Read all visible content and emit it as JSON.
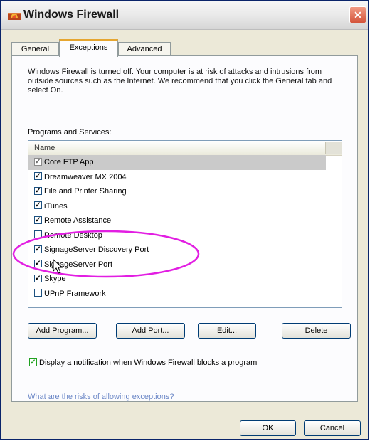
{
  "window": {
    "title": "Windows Firewall"
  },
  "tabs": [
    {
      "label": "General",
      "active": false
    },
    {
      "label": "Exceptions",
      "active": true
    },
    {
      "label": "Advanced",
      "active": false
    }
  ],
  "exceptions": {
    "warning": "Windows Firewall is turned off. Your computer is at risk of attacks and intrusions from outside sources such as the Internet. We recommend that you click the General tab and select On.",
    "section_label": "Programs and Services:",
    "column_header": "Name",
    "items": [
      {
        "label": "Core FTP App",
        "checked": true,
        "selected": true
      },
      {
        "label": "Dreamweaver MX 2004",
        "checked": true,
        "selected": false
      },
      {
        "label": "File and Printer Sharing",
        "checked": true,
        "selected": false
      },
      {
        "label": "iTunes",
        "checked": true,
        "selected": false
      },
      {
        "label": "Remote Assistance",
        "checked": true,
        "selected": false
      },
      {
        "label": "Remote Desktop",
        "checked": false,
        "selected": false
      },
      {
        "label": "SignageServer Discovery Port",
        "checked": true,
        "selected": false
      },
      {
        "label": "SignageServer Port",
        "checked": true,
        "selected": false
      },
      {
        "label": "Skype",
        "checked": true,
        "selected": false
      },
      {
        "label": "UPnP Framework",
        "checked": false,
        "selected": false
      }
    ],
    "buttons": {
      "add_program": "Add Program...",
      "add_port": "Add Port...",
      "edit": "Edit...",
      "delete": "Delete"
    },
    "notify_label": "Display a notification when Windows Firewall blocks a program",
    "notify_checked": true,
    "risk_link": "What are the risks of allowing exceptions?"
  },
  "dialog_buttons": {
    "ok": "OK",
    "cancel": "Cancel"
  },
  "colors": {
    "highlight_ellipse": "#e21ee2",
    "active_tab_accent": "#e6a630",
    "selected_row": "#cacaca",
    "link": "#6a86c6"
  },
  "icons": {
    "app": "firewall-icon",
    "close": "close-icon",
    "cursor": "mouse-pointer-icon"
  }
}
